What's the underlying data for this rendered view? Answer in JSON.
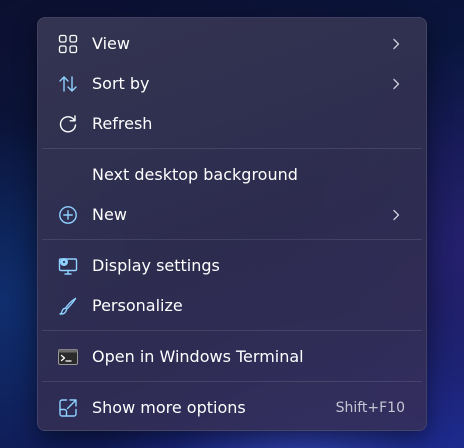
{
  "context_menu": {
    "items": [
      {
        "label": "View",
        "icon": "grid-icon",
        "has_submenu": true
      },
      {
        "label": "Sort by",
        "icon": "sort-arrows-icon",
        "has_submenu": true
      },
      {
        "label": "Refresh",
        "icon": "refresh-icon",
        "has_submenu": false
      },
      {
        "label": "Next desktop background",
        "icon": null,
        "has_submenu": false
      },
      {
        "label": "New",
        "icon": "plus-circle-icon",
        "has_submenu": true
      },
      {
        "label": "Display settings",
        "icon": "display-settings-icon",
        "has_submenu": false
      },
      {
        "label": "Personalize",
        "icon": "brush-icon",
        "has_submenu": false
      },
      {
        "label": "Open in Windows Terminal",
        "icon": "terminal-icon",
        "has_submenu": false
      },
      {
        "label": "Show more options",
        "icon": "open-external-icon",
        "shortcut": "Shift+F10"
      }
    ]
  },
  "colors": {
    "accent_icon": "#8fd1ff",
    "text": "#ffffff",
    "menu_background": "#35345a"
  }
}
